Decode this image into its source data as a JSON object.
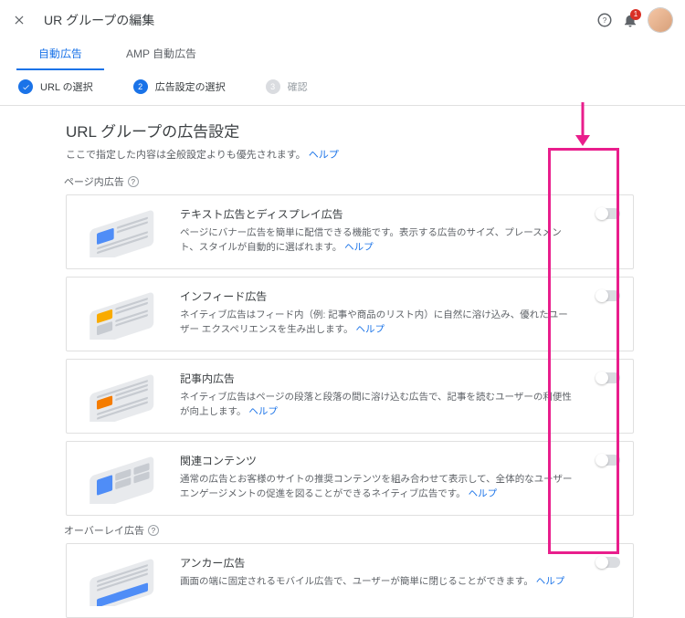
{
  "header": {
    "title": "UR グループの編集",
    "notifications_badge": "1"
  },
  "tabs": [
    {
      "label": "自動広告",
      "active": true
    },
    {
      "label": "AMP 自動広告",
      "active": false
    }
  ],
  "steps": [
    {
      "label": "URL の選択",
      "state": "done"
    },
    {
      "label": "広告設定の選択",
      "state": "active",
      "num": "2"
    },
    {
      "label": "確認",
      "state": "todo",
      "num": "3"
    }
  ],
  "section": {
    "heading": "URL グループの広告設定",
    "subtitle_pre": "ここで指定した内容は全般設定よりも優先されます。 ",
    "subtitle_link": "ヘルプ"
  },
  "group1_label": "ページ内広告",
  "group2_label": "オーバーレイ広告",
  "help_link": "ヘルプ",
  "cards": [
    {
      "title": "テキスト広告とディスプレイ広告",
      "desc": "ページにバナー広告を簡単に配信できる機能です。表示する広告のサイズ、プレースメント、スタイルが自動的に選ばれます。 "
    },
    {
      "title": "インフィード広告",
      "desc": "ネイティブ広告はフィード内（例: 記事や商品のリスト内）に自然に溶け込み、優れたユーザー エクスペリエンスを生み出します。 "
    },
    {
      "title": "記事内広告",
      "desc": "ネイティブ広告はページの段落と段落の間に溶け込む広告で、記事を読むユーザーの利便性が向上します。 "
    },
    {
      "title": "関連コンテンツ",
      "desc": "通常の広告とお客様のサイトの推奨コンテンツを組み合わせて表示して、全体的なユーザー エンゲージメントの促進を図ることができるネイティブ広告です。 "
    },
    {
      "title": "アンカー広告",
      "desc": "画面の端に固定されるモバイル広告で、ユーザーが簡単に閉じることができます。 "
    }
  ]
}
